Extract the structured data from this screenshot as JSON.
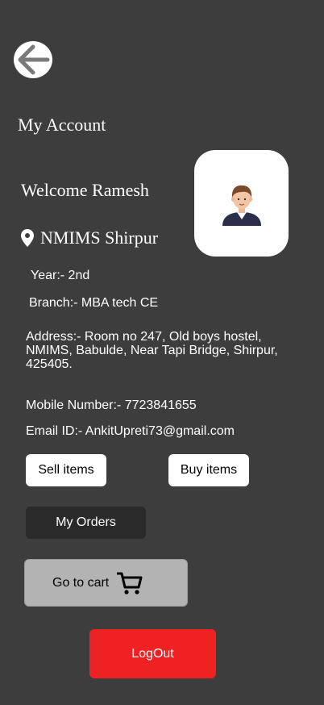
{
  "header": {
    "title": "My Account"
  },
  "profile": {
    "welcome": "Welcome Ramesh",
    "location": "NMIMS Shirpur",
    "year": "Year:- 2nd",
    "branch": "Branch:- MBA tech CE",
    "address": "Address:- Room no 247, Old boys hostel, NMIMS, Babulde, Near Tapi Bridge, Shirpur, 425405.",
    "mobile": "Mobile Number:- 7723841655",
    "email": "Email ID:- AnkitUpreti73@gmail.com"
  },
  "actions": {
    "sell_label": "Sell items",
    "buy_label": "Buy items",
    "orders_label": "My Orders",
    "cart_label": "Go to cart",
    "logout_label": "LogOut"
  },
  "icons": {
    "back": "arrow-left-icon",
    "location": "location-pin-icon",
    "avatar": "user-avatar-icon",
    "cart": "shopping-cart-icon"
  },
  "colors": {
    "background": "#3d3d3d",
    "orders_button": "#2a2a2a",
    "cart_button": "#b3b3b3",
    "logout_button": "#ee2222"
  }
}
